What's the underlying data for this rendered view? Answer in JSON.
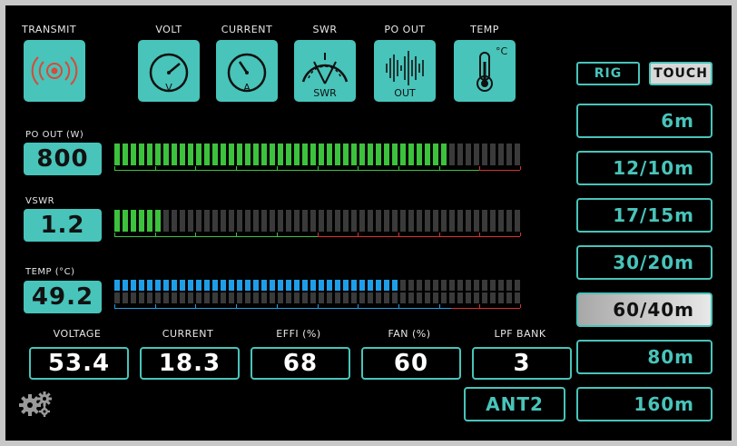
{
  "toolbar": {
    "transmit_label": "TRANSMIT",
    "volt_label": "VOLT",
    "current_label": "CURRENT",
    "swr_label": "SWR",
    "po_out_label": "PO OUT",
    "temp_label": "TEMP",
    "volt_icon_text": "V",
    "current_icon_text": "A",
    "swr_icon_text": "SWR",
    "out_icon_text": "OUT",
    "temp_icon_text": "°C"
  },
  "meters": {
    "po_out": {
      "label": "PO OUT (W)",
      "value": "800",
      "level": 0.81,
      "color": "#3cc23c"
    },
    "vswr": {
      "label": "VSWR",
      "value": "1.2",
      "level": 0.12,
      "color": "#3cc23c"
    },
    "temp": {
      "label": "TEMP (°C)",
      "value": "49.2",
      "level": 0.7,
      "color": "#1e9ee8"
    }
  },
  "readouts": [
    {
      "label": "VOLTAGE",
      "value": "53.4"
    },
    {
      "label": "CURRENT",
      "value": "18.3"
    },
    {
      "label": "EFFI (%)",
      "value": "68"
    },
    {
      "label": "FAN (%)",
      "value": "60"
    },
    {
      "label": "LPF BANK",
      "value": "3"
    }
  ],
  "antenna": {
    "value": "ANT2"
  },
  "mode": {
    "rig_label": "RIG",
    "touch_label": "TOUCH"
  },
  "bands": [
    {
      "label": "6m",
      "selected": false
    },
    {
      "label": "12/10m",
      "selected": false
    },
    {
      "label": "17/15m",
      "selected": false
    },
    {
      "label": "30/20m",
      "selected": false
    },
    {
      "label": "60/40m",
      "selected": true
    },
    {
      "label": "80m",
      "selected": false
    },
    {
      "label": "160m",
      "selected": false
    }
  ],
  "colors": {
    "accent": "#48c4ba",
    "transmit_icon": "#d84a3a"
  },
  "icons": {
    "settings": "gears-icon",
    "transmit": "broadcast-icon"
  }
}
